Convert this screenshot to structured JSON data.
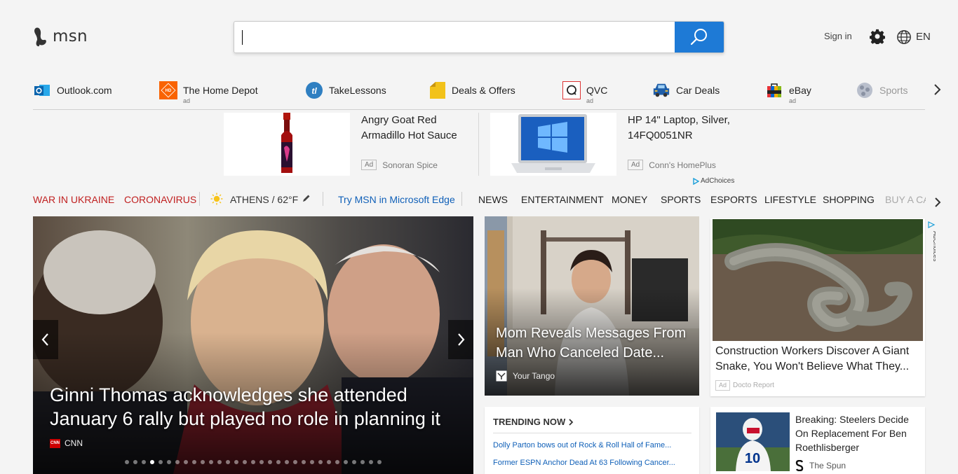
{
  "header": {
    "logo_text": "msn",
    "search_value": "",
    "signin_label": "Sign in",
    "language": "EN"
  },
  "quicklinks": [
    {
      "label": "Outlook.com",
      "icon": "outlook-icon",
      "ad": ""
    },
    {
      "label": "The Home Depot",
      "icon": "home-depot-icon",
      "ad": "ad"
    },
    {
      "label": "TakeLessons",
      "icon": "takelessons-icon",
      "ad": ""
    },
    {
      "label": "Deals & Offers",
      "icon": "deals-tag-icon",
      "ad": ""
    },
    {
      "label": "QVC",
      "icon": "qvc-icon",
      "ad": "ad"
    },
    {
      "label": "Car Deals",
      "icon": "car-icon",
      "ad": ""
    },
    {
      "label": "eBay",
      "icon": "ebay-bag-icon",
      "ad": "ad"
    },
    {
      "label": "Sports",
      "icon": "sports-icon",
      "ad": ""
    }
  ],
  "ads": [
    {
      "title": "Angry Goat Red Armadillo Hot Sauce",
      "badge": "Ad",
      "sponsor": "Sonoran Spice"
    },
    {
      "title": "HP 14\" Laptop, Silver, 14FQ0051NR",
      "badge": "Ad",
      "sponsor": "Conn's HomePlus"
    }
  ],
  "adchoices_label": "AdChoices",
  "nav": {
    "topics": [
      "WAR IN UKRAINE",
      "CORONAVIRUS"
    ],
    "weather": "ATHENS / 62°F",
    "edge_promo": "Try MSN in Microsoft Edge",
    "sections": [
      "NEWS",
      "ENTERTAINMENT",
      "MONEY",
      "SPORTS",
      "ESPORTS",
      "LIFESTYLE",
      "SHOPPING",
      "BUY A CAR"
    ]
  },
  "hero": {
    "title": "Ginni Thomas acknowledges she attended January 6 rally but played no role in planning it",
    "source": "CNN",
    "slide_count": 31,
    "active_slide": 4
  },
  "mid_story": {
    "title": "Mom Reveals Messages From Man Who Canceled Date...",
    "source": "Your Tango"
  },
  "right_ad": {
    "title": "Construction Workers Discover A Giant Snake, You Won't Believe What They...",
    "badge": "Ad",
    "sponsor": "Docto Report"
  },
  "trending": {
    "heading": "TRENDING NOW",
    "items": [
      "Dolly Parton bows out of Rock & Roll Hall of Fame...",
      "Former ESPN Anchor Dead At 63 Following Cancer..."
    ]
  },
  "breaking": {
    "title": "Breaking: Steelers Decide On Replacement For Ben Roethlisberger",
    "source": "The Spun"
  },
  "colors": {
    "accent_blue": "#1e7ad6",
    "topic_red": "#c02020",
    "link_blue": "#1060b8"
  }
}
